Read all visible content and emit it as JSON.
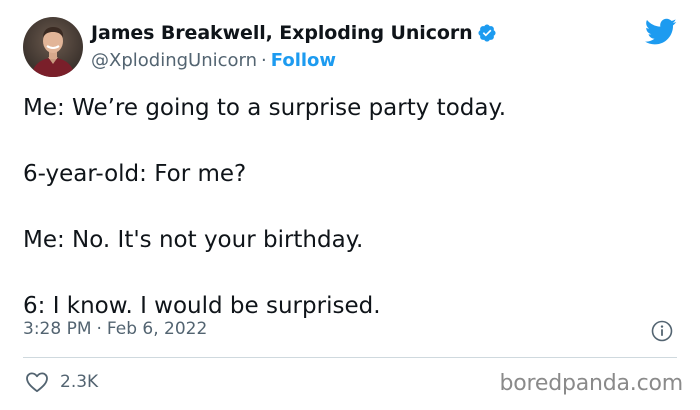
{
  "author": {
    "display_name": "James Breakwell, Exploding Unicorn",
    "handle": "@XplodingUnicorn",
    "separator": "·",
    "follow_label": "Follow",
    "verified": true
  },
  "tweet": {
    "lines": [
      "Me: We’re going to a surprise party today.",
      "6-year-old: For me?",
      "Me: No. It's not your birthday.",
      "6: I know. I would be surprised."
    ],
    "time": "3:28 PM",
    "separator": "·",
    "date": "Feb 6, 2022",
    "like_count": "2.3K"
  },
  "watermark": "boredpanda.com",
  "icons": {
    "platform": "twitter-bird-icon",
    "verified": "verified-badge-icon",
    "info": "info-icon",
    "like": "heart-icon"
  },
  "colors": {
    "accent": "#1d9bf0",
    "text_primary": "#0f1419",
    "text_secondary": "#536471",
    "divider": "#cfd9de",
    "watermark": "#8a8a8a"
  }
}
